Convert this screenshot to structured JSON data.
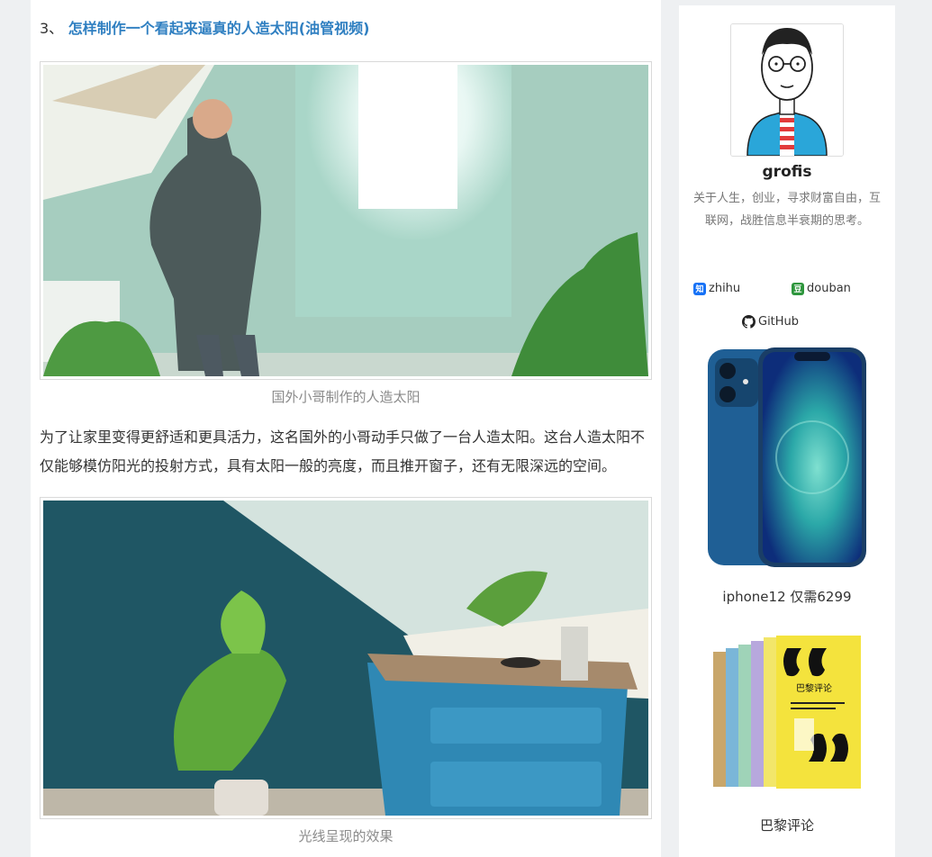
{
  "article": {
    "heading_number": "3、",
    "heading_link": "怎样制作一个看起来逼真的人造太阳(油管视频)",
    "figure1_caption": "国外小哥制作的人造太阳",
    "paragraph": "为了让家里变得更舒适和更具活力，这名国外的小哥动手只做了一台人造太阳。这台人造太阳不仅能够模仿阳光的投射方式，具有太阳一般的亮度，而且推开窗子，还有无限深远的空间。",
    "figure2_caption": "光线呈现的效果"
  },
  "sidebar": {
    "author": "grofis",
    "bio": "关于人生，创业，寻求财富自由，互联网，战胜信息半衰期的思考。",
    "social": [
      {
        "icon": "zhihu-icon",
        "badge": "知",
        "label": "zhihu",
        "color": "#1772f6"
      },
      {
        "icon": "douban-icon",
        "badge": "豆",
        "label": "douban",
        "color": "#2e963d"
      },
      {
        "icon": "github-icon",
        "label": "GitHub"
      }
    ],
    "ads": [
      {
        "label": "iphone12 仅需6299"
      },
      {
        "label": "巴黎评论"
      }
    ],
    "book_cover_text": "巴黎评论"
  },
  "colors": {
    "link": "#2f7fc1",
    "page_bg": "#eef0f2",
    "iphone_blue": "#1f5f95"
  }
}
